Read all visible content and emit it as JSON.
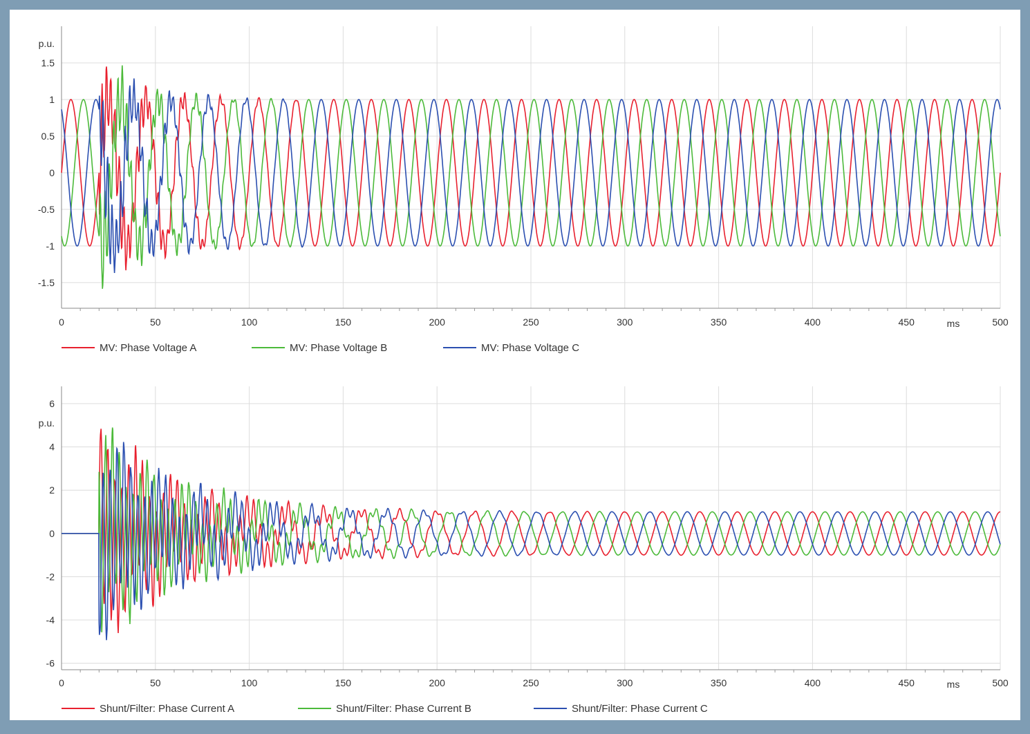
{
  "chart_data": [
    {
      "type": "line",
      "ylabel": "p.u.",
      "xunit": "ms",
      "xlim": [
        0,
        500
      ],
      "ylim": [
        -1.85,
        2.0
      ],
      "xticks": [
        0,
        50,
        100,
        150,
        200,
        250,
        300,
        350,
        400,
        450,
        500
      ],
      "yticks": [
        1.5,
        1,
        0.5,
        0,
        -0.5,
        -1,
        -1.5
      ],
      "ytick_labels": [
        "1.5",
        "1",
        "0.5",
        "0",
        "-0.5",
        "-1",
        "-1.5"
      ],
      "grid": true,
      "legend_position": "bottom",
      "signal": {
        "frequency_hz": 50,
        "fault_start_ms": 20,
        "disturbance_end_ms": 110,
        "steady_amplitude": 1.0,
        "peak_disturbance": 1.7
      },
      "series": [
        {
          "name": "MV: Phase Voltage A",
          "color": "#e8202e",
          "phase_deg": 0
        },
        {
          "name": "MV: Phase Voltage B",
          "color": "#4cba3a",
          "phase_deg": -120
        },
        {
          "name": "MV: Phase Voltage C",
          "color": "#2b4fb0",
          "phase_deg": 120
        }
      ]
    },
    {
      "type": "line",
      "ylabel": "p.u.",
      "xunit": "ms",
      "xlim": [
        0,
        500
      ],
      "ylim": [
        -6.3,
        6.8
      ],
      "xticks": [
        0,
        50,
        100,
        150,
        200,
        250,
        300,
        350,
        400,
        450,
        500
      ],
      "yticks": [
        6,
        4,
        2,
        0,
        -2,
        -4,
        -6
      ],
      "ytick_labels": [
        "6",
        "4",
        "2",
        "0",
        "-2",
        "-4",
        "-6"
      ],
      "grid": true,
      "legend_position": "bottom",
      "signal": {
        "frequency_hz": 50,
        "switch_on_ms": 20,
        "disturbance_end_ms": 210,
        "steady_amplitude": 1.0,
        "peak_disturbance": 5.6
      },
      "series": [
        {
          "name": "Shunt/Filter: Phase Current A",
          "color": "#e8202e",
          "phase_deg": 90
        },
        {
          "name": "Shunt/Filter: Phase Current B",
          "color": "#4cba3a",
          "phase_deg": -30
        },
        {
          "name": "Shunt/Filter: Phase Current C",
          "color": "#2b4fb0",
          "phase_deg": 210
        }
      ]
    }
  ]
}
